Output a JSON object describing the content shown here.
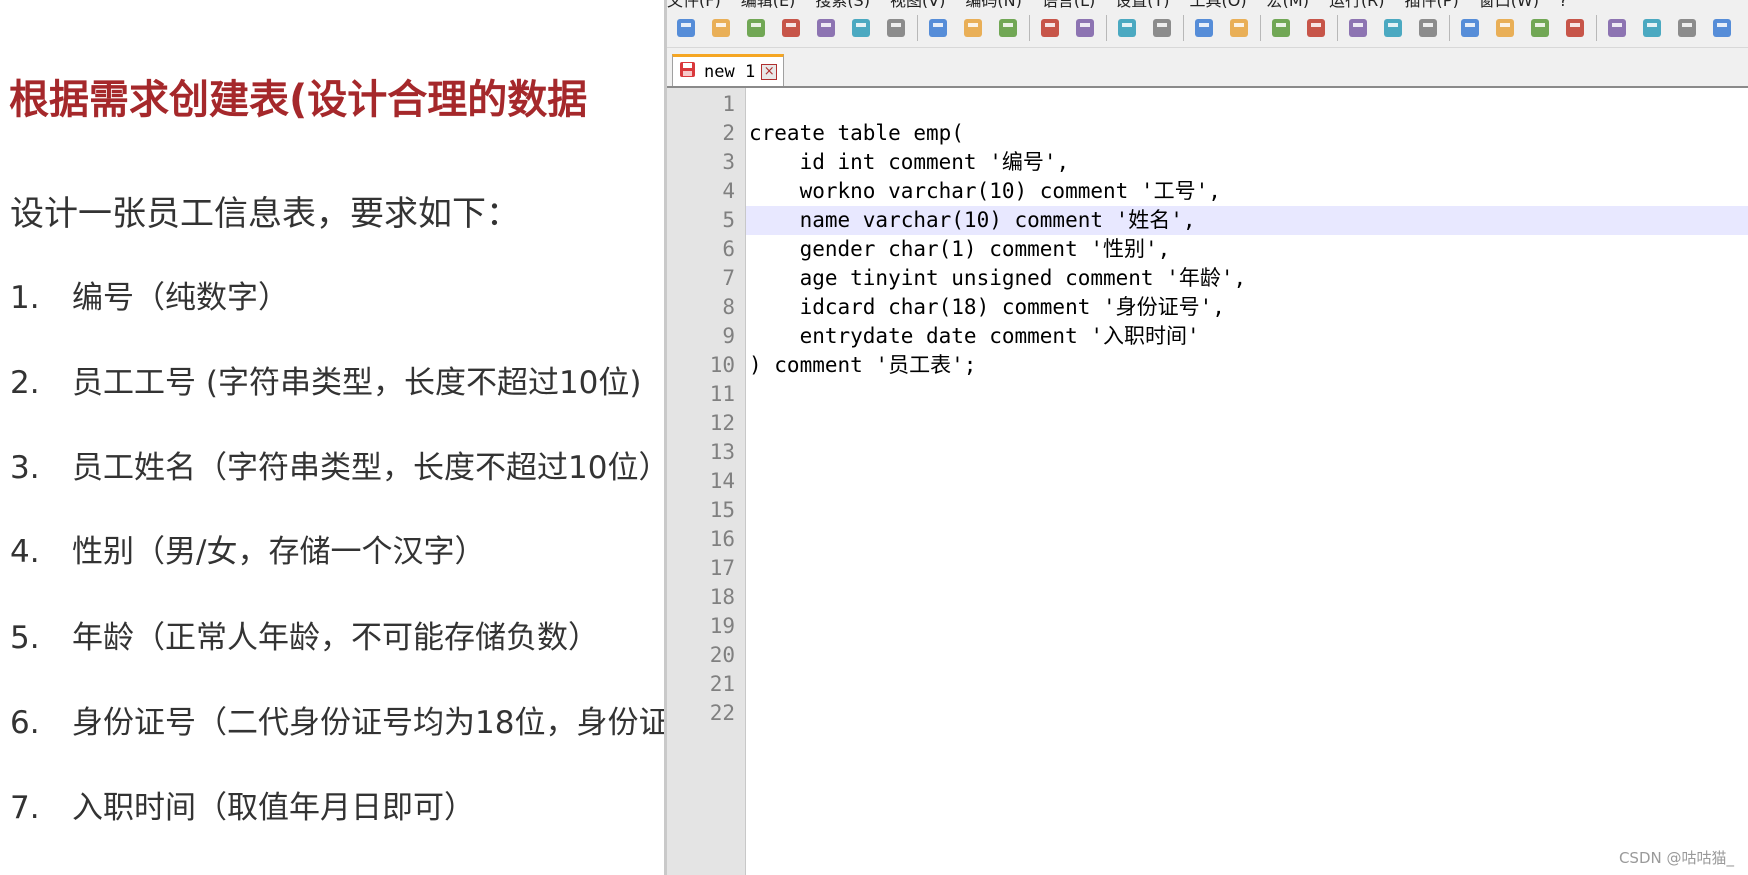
{
  "slide": {
    "title": "根据需求创建表(设计合理的数据",
    "subtitle": "设计一张员工信息表，要求如下：",
    "requirements": [
      {
        "num": "1.",
        "text": "编号（纯数字）"
      },
      {
        "num": "2.",
        "text": "员工工号 (字符串类型，长度不超过10位)"
      },
      {
        "num": "3.",
        "text": "员工姓名（字符串类型，长度不超过10位）"
      },
      {
        "num": "4.",
        "text": "性别（男/女，存储一个汉字）"
      },
      {
        "num": "5.",
        "text": "年龄（正常人年龄，不可能存储负数）"
      },
      {
        "num": "6.",
        "text": "身份证号（二代身份证号均为18位，身份证"
      },
      {
        "num": "7.",
        "text": "入职时间（取值年月日即可）"
      }
    ]
  },
  "editor": {
    "menu_items": [
      "文件(F)",
      "编辑(E)",
      "搜索(S)",
      "视图(V)",
      "编码(N)",
      "语言(L)",
      "设置(T)",
      "工具(O)",
      "宏(M)",
      "运行(R)",
      "插件(P)",
      "窗口(W)",
      "?"
    ],
    "toolbar_icons": [
      "new-file-icon",
      "open-file-icon",
      "save-icon",
      "save-all-icon",
      "close-icon",
      "close-all-icon",
      "print-icon",
      "sep",
      "cut-icon",
      "copy-icon",
      "paste-icon",
      "sep",
      "undo-icon",
      "redo-icon",
      "sep",
      "find-icon",
      "replace-icon",
      "sep",
      "zoom-in-icon",
      "zoom-out-icon",
      "sep",
      "sync-vertical-icon",
      "sync-horizontal-icon",
      "sep",
      "word-wrap-icon",
      "show-all-chars-icon",
      "indent-guide-icon",
      "sep",
      "doc-map-icon",
      "function-list-icon",
      "folder-workspace-icon",
      "monitor-icon",
      "sep",
      "record-macro-icon",
      "stop-macro-icon",
      "play-macro-icon",
      "run-macro-icon"
    ],
    "tab": {
      "label": "new 1",
      "close_symbol": "×"
    },
    "line_numbers": [
      "1",
      "2",
      "3",
      "4",
      "5",
      "6",
      "7",
      "8",
      "9",
      "10",
      "11",
      "12",
      "13",
      "14",
      "15",
      "16",
      "17",
      "18",
      "19",
      "20",
      "21",
      "22"
    ],
    "current_line": 5,
    "code_lines": [
      "",
      "create table emp(",
      "    id int comment '编号',",
      "    workno varchar(10) comment '工号',",
      "    name varchar(10) comment '姓名',",
      "    gender char(1) comment '性别',",
      "    age tinyint unsigned comment '年龄',",
      "    idcard char(18) comment '身份证号',",
      "    entrydate date comment '入职时间'",
      ") comment '员工表';",
      "",
      "",
      "",
      "",
      "",
      "",
      "",
      "",
      "",
      "",
      "",
      ""
    ],
    "cursor_glyph": "I"
  },
  "watermark": "CSDN @咕咕猫_",
  "colors": {
    "title_red": "#a5282b",
    "tab_accent": "#f5a623",
    "current_line_bg": "#e8e8ff",
    "gutter_bg": "#e4e4e4"
  }
}
